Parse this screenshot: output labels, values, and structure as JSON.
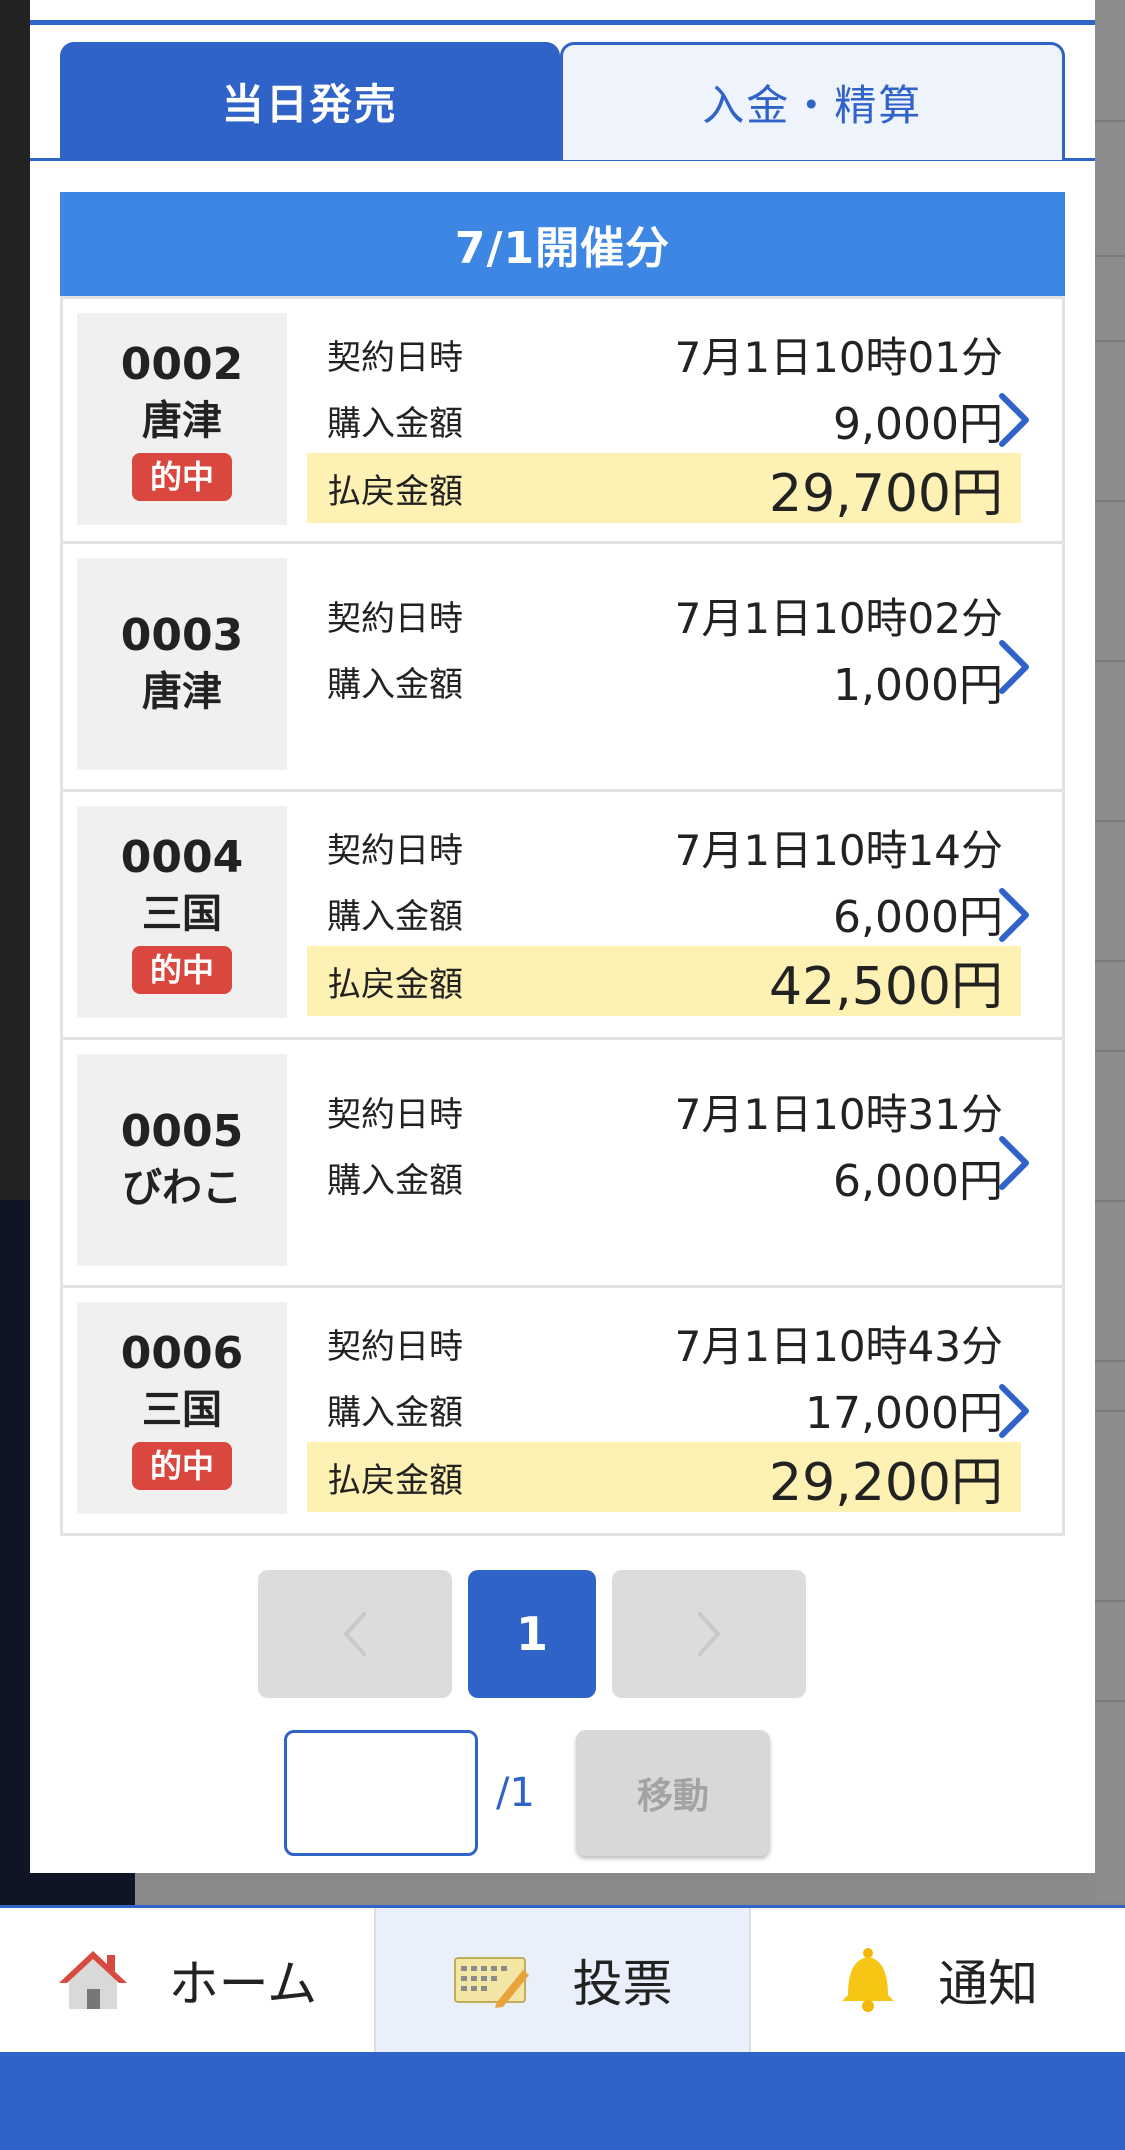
{
  "tabs": [
    {
      "label": "当日発売",
      "active": true
    },
    {
      "label": "入金・精算",
      "active": false
    }
  ],
  "date_header": "7/1開催分",
  "labels": {
    "contract": "契約日時",
    "purchase": "購入金額",
    "payout": "払戻金額",
    "hit": "的中"
  },
  "tickets": [
    {
      "race_no": "0002",
      "venue": "唐津",
      "hit": true,
      "contract_time": "7月1日10時01分",
      "purchase": "9,000円",
      "payout": "29,700円"
    },
    {
      "race_no": "0003",
      "venue": "唐津",
      "hit": false,
      "contract_time": "7月1日10時02分",
      "purchase": "1,000円",
      "payout": ""
    },
    {
      "race_no": "0004",
      "venue": "三国",
      "hit": true,
      "contract_time": "7月1日10時14分",
      "purchase": "6,000円",
      "payout": "42,500円"
    },
    {
      "race_no": "0005",
      "venue": "びわこ",
      "hit": false,
      "contract_time": "7月1日10時31分",
      "purchase": "6,000円",
      "payout": ""
    },
    {
      "race_no": "0006",
      "venue": "三国",
      "hit": true,
      "contract_time": "7月1日10時43分",
      "purchase": "17,000円",
      "payout": "29,200円"
    }
  ],
  "pagination": {
    "current_page": "1",
    "total": "/1",
    "input_value": "",
    "move_label": "移動"
  },
  "bottom_nav": [
    {
      "label": "ホーム",
      "icon": "home-icon",
      "active": false
    },
    {
      "label": "投票",
      "icon": "vote-ticket-icon",
      "active": true
    },
    {
      "label": "通知",
      "icon": "bell-icon",
      "active": false
    }
  ],
  "colors": {
    "primary": "#2f63c8",
    "header": "#3d86e4",
    "hit_badge": "#d9473f",
    "payout_bg": "#fdf1b3"
  }
}
